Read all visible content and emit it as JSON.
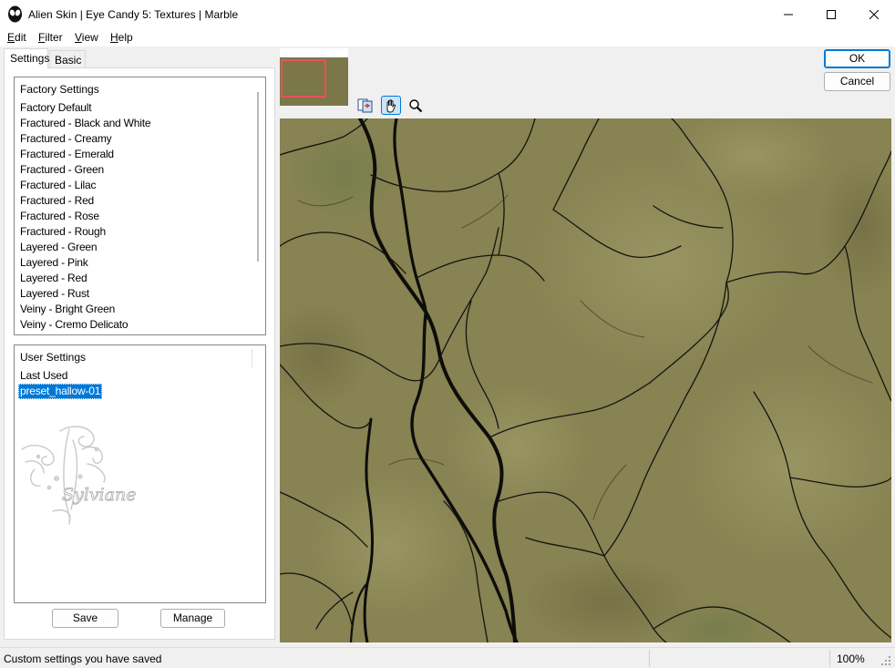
{
  "window": {
    "title": "Alien Skin | Eye Candy 5: Textures | Marble"
  },
  "menu": [
    {
      "accel": "E",
      "rest": "dit"
    },
    {
      "accel": "F",
      "rest": "ilter"
    },
    {
      "accel": "V",
      "rest": "iew"
    },
    {
      "accel": "H",
      "rest": "elp"
    }
  ],
  "tabs": {
    "settings": "Settings",
    "basic": "Basic"
  },
  "factory": {
    "header": "Factory Settings",
    "items": [
      "Factory Default",
      "Fractured - Black and White",
      "Fractured - Creamy",
      "Fractured - Emerald",
      "Fractured - Green",
      "Fractured - Lilac",
      "Fractured - Red",
      "Fractured - Rose",
      "Fractured - Rough",
      "Layered - Green",
      "Layered - Pink",
      "Layered - Red",
      "Layered - Rust",
      "Veiny - Bright Green",
      "Veiny - Cremo Delicato"
    ]
  },
  "user": {
    "header": "User Settings",
    "items": [
      "Last Used",
      "preset_hallow-01"
    ],
    "selected_index": 1,
    "watermark_text": "Sylviane"
  },
  "buttons": {
    "save": "Save",
    "manage": "Manage",
    "ok": "OK",
    "cancel": "Cancel"
  },
  "tools": [
    {
      "name": "compare-tool-icon"
    },
    {
      "name": "hand-tool-icon",
      "active": true
    },
    {
      "name": "zoom-tool-icon"
    }
  ],
  "preview": {
    "texture": "Marble",
    "base_color": "#8a8655",
    "vein_color": "#0d0d0a"
  },
  "status": {
    "message": "Custom settings you have saved",
    "zoom": "100%"
  },
  "colors": {
    "selection": "#0078d7",
    "thumb_frame": "#e8525c",
    "default_button": "#0078d7"
  }
}
